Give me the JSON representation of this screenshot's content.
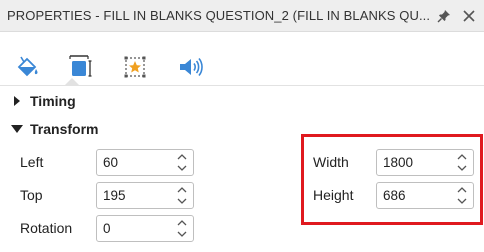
{
  "panel": {
    "title": "PROPERTIES - FILL IN BLANKS QUESTION_2 (FILL IN BLANKS QU...",
    "pin_icon": "pin-icon",
    "close_icon": "close-icon"
  },
  "tabs": [
    {
      "name": "fill-bucket-icon",
      "active": false
    },
    {
      "name": "size-position-icon",
      "active": true
    },
    {
      "name": "star-effect-icon",
      "active": false
    },
    {
      "name": "speaker-icon",
      "active": false
    }
  ],
  "sections": {
    "timing": {
      "label": "Timing",
      "expanded": false
    },
    "transform": {
      "label": "Transform",
      "expanded": true
    }
  },
  "fields": {
    "left": {
      "label": "Left",
      "value": "60"
    },
    "top": {
      "label": "Top",
      "value": "195"
    },
    "rotation": {
      "label": "Rotation",
      "value": "0"
    },
    "width": {
      "label": "Width",
      "value": "1800"
    },
    "height": {
      "label": "Height",
      "value": "686"
    }
  },
  "colors": {
    "accent": "#3a87d6",
    "highlight": "#e0191f",
    "star": "#f0a020"
  }
}
